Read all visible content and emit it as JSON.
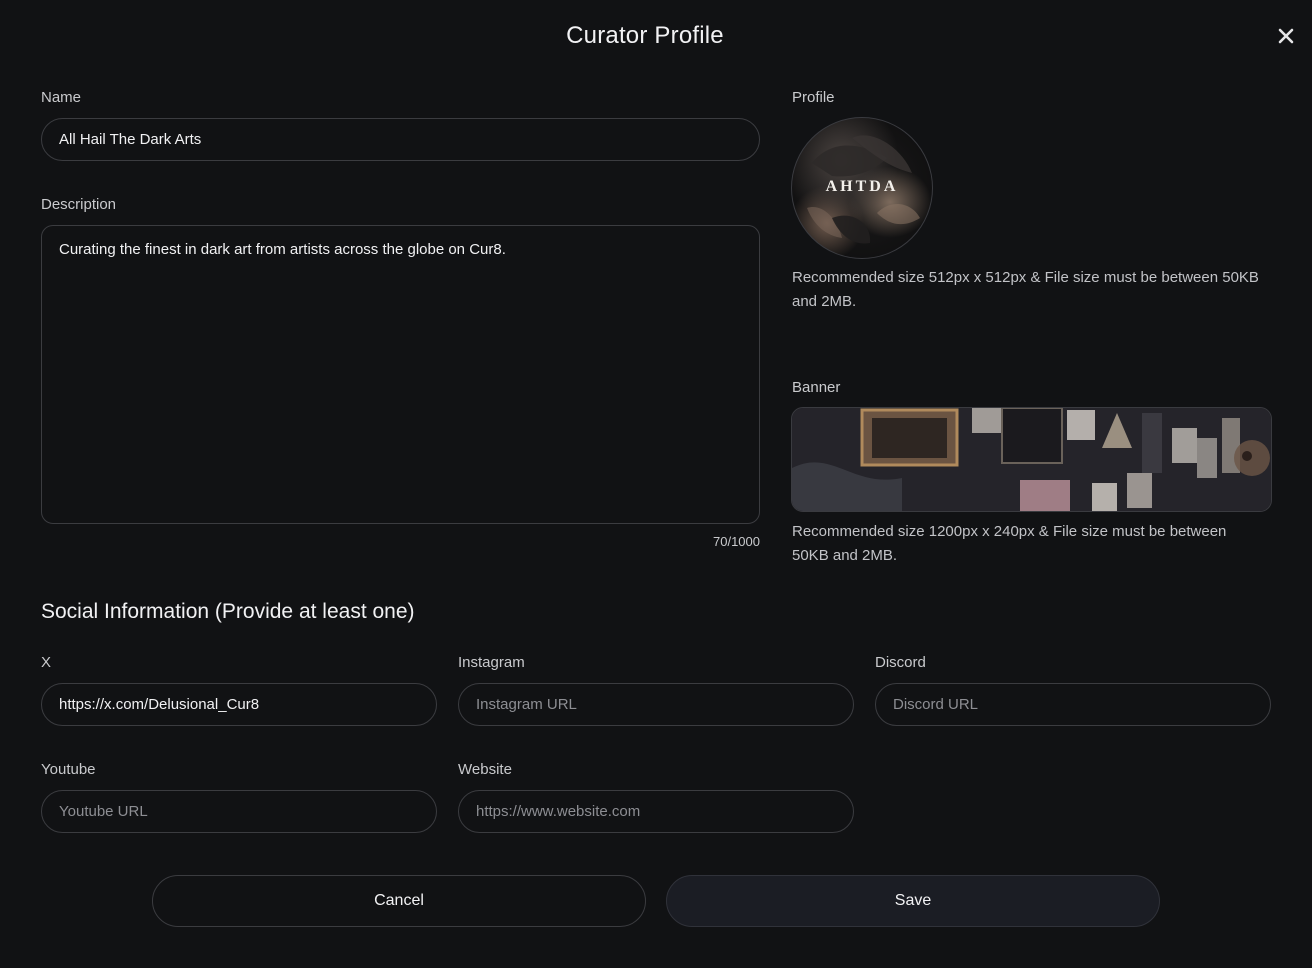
{
  "modal": {
    "title": "Curator Profile",
    "close_icon": "close-icon"
  },
  "name": {
    "label": "Name",
    "value": "All Hail The Dark Arts"
  },
  "description": {
    "label": "Description",
    "value": "Curating the finest in dark art from artists across the globe on Cur8.",
    "counter": "70/1000"
  },
  "profile": {
    "label": "Profile",
    "avatar_text": "AHTDA",
    "hint": "Recommended size 512px x 512px & File size must be between 50KB and 2MB."
  },
  "banner": {
    "label": "Banner",
    "hint": "Recommended size 1200px x 240px & File size must be between 50KB and 2MB."
  },
  "social": {
    "title": "Social Information (Provide at least one)",
    "x": {
      "label": "X",
      "value": "https://x.com/Delusional_Cur8",
      "placeholder": ""
    },
    "instagram": {
      "label": "Instagram",
      "value": "",
      "placeholder": "Instagram URL"
    },
    "discord": {
      "label": "Discord",
      "value": "",
      "placeholder": "Discord URL"
    },
    "youtube": {
      "label": "Youtube",
      "value": "",
      "placeholder": "Youtube URL"
    },
    "website": {
      "label": "Website",
      "value": "",
      "placeholder": "https://www.website.com"
    }
  },
  "actions": {
    "cancel_label": "Cancel",
    "save_label": "Save"
  },
  "colors": {
    "background": "#111214",
    "border": "#3b3c40",
    "save_bg": "#1b1d24",
    "text": "#f1f1f3",
    "muted": "#c9cacd"
  }
}
